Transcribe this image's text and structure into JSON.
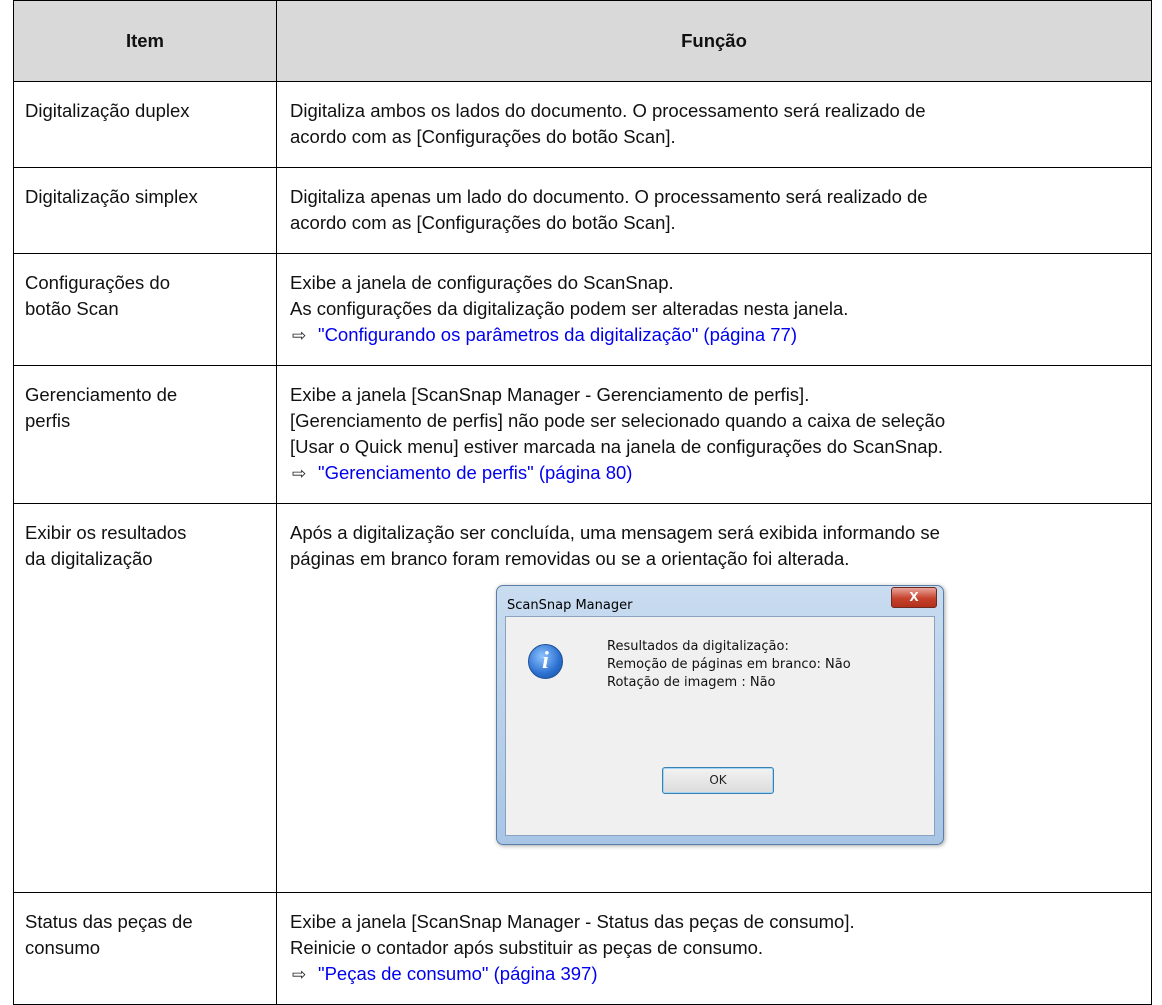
{
  "header": {
    "item": "Item",
    "function": "Função"
  },
  "rows": [
    {
      "item": "Digitalização duplex",
      "lines": [
        "Digitaliza ambos os lados do documento. O processamento será realizado de",
        "acordo com as [Configurações do botão Scan]."
      ]
    },
    {
      "item": "Digitalização simplex",
      "lines": [
        "Digitaliza apenas um lado do documento. O processamento será realizado de",
        "acordo com as [Configurações do botão Scan]."
      ]
    },
    {
      "item_lines": [
        "Configurações do",
        "botão Scan"
      ],
      "lines": [
        "Exibe a janela de configurações do ScanSnap.",
        "As configurações da digitalização podem ser alteradas nesta janela."
      ],
      "link": "\"Configurando os parâmetros da digitalização\" (página 77)"
    },
    {
      "item_lines": [
        "Gerenciamento de",
        "perfis"
      ],
      "lines": [
        "Exibe a janela [ScanSnap Manager - Gerenciamento de perfis].",
        "[Gerenciamento de perfis] não pode ser selecionado quando a caixa de seleção",
        "[Usar o Quick menu] estiver marcada na janela de configurações do ScanSnap."
      ],
      "link": "\"Gerenciamento de perfis\" (página 80)"
    },
    {
      "item_lines": [
        "Exibir os resultados",
        "da digitalização"
      ],
      "lines": [
        "Após a digitalização ser concluída, uma mensagem será exibida informando se",
        "páginas em branco foram removidas ou se a orientação foi alterada."
      ]
    },
    {
      "item_lines": [
        "Status das peças de",
        "consumo"
      ],
      "lines": [
        "Exibe a janela [ScanSnap Manager - Status das peças de consumo].",
        "Reinicie o contador após substituir as peças de consumo."
      ],
      "link": "\"Peças de consumo\" (página 397)"
    }
  ],
  "dialog": {
    "title": "ScanSnap Manager",
    "close": "X",
    "message": [
      "Resultados da digitalização:",
      "Remoção de páginas em branco: Não",
      "Rotação de imagem : Não"
    ],
    "ok": "OK",
    "icon": "info-icon"
  },
  "link_arrow": "⇨"
}
